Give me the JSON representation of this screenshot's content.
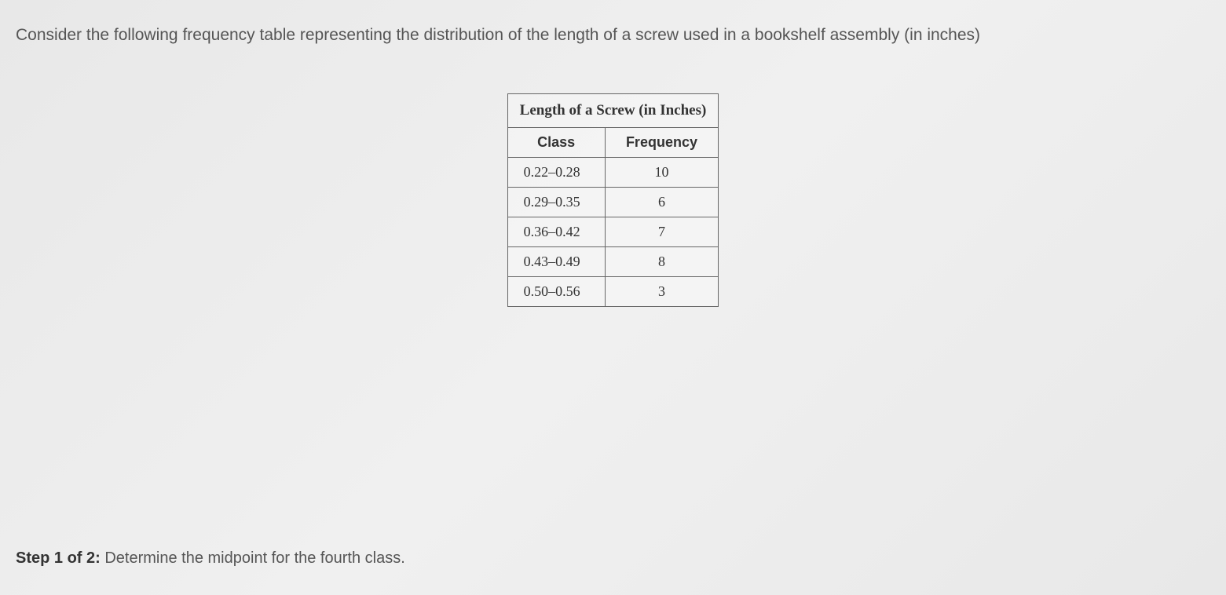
{
  "question": "Consider the following frequency table representing the distribution of the length of a screw used in a bookshelf assembly (in inches)",
  "table": {
    "title": "Length of a Screw (in Inches)",
    "headers": {
      "class": "Class",
      "frequency": "Frequency"
    },
    "rows": [
      {
        "class": "0.22–0.28",
        "frequency": "10"
      },
      {
        "class": "0.29–0.35",
        "frequency": "6"
      },
      {
        "class": "0.36–0.42",
        "frequency": "7"
      },
      {
        "class": "0.43–0.49",
        "frequency": "8"
      },
      {
        "class": "0.50–0.56",
        "frequency": "3"
      }
    ]
  },
  "step": {
    "label": "Step 1 of 2:",
    "instruction": " Determine the midpoint for the fourth class."
  }
}
